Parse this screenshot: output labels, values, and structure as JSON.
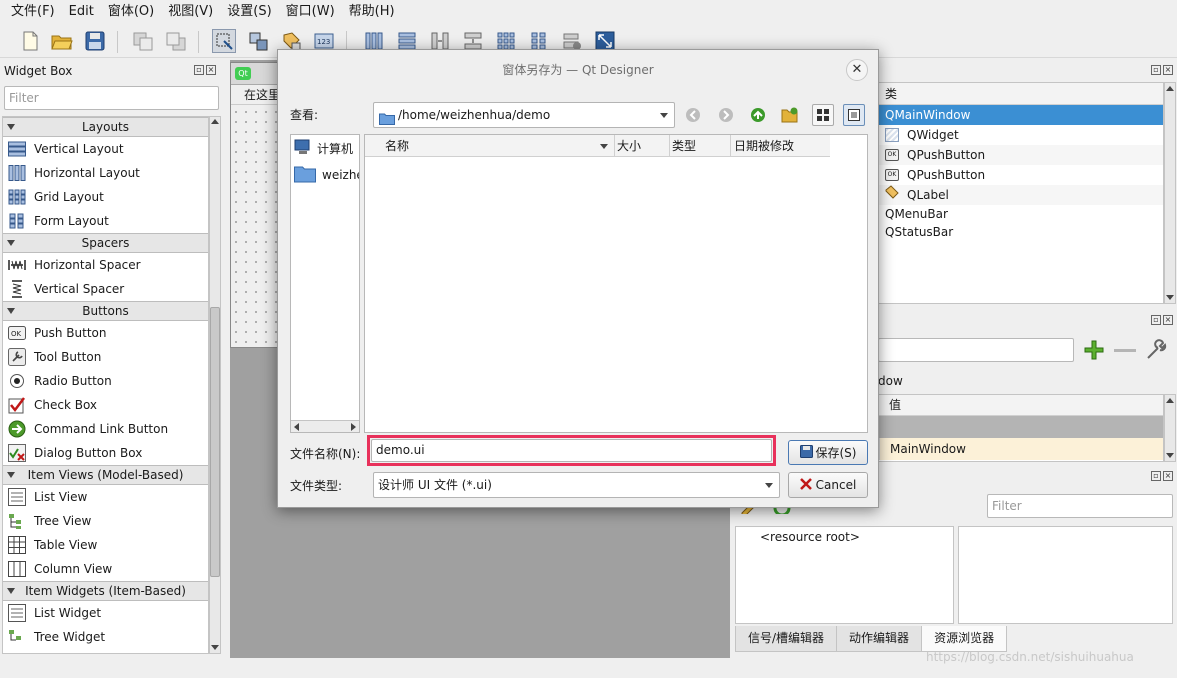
{
  "menubar": {
    "items": [
      "文件(F)",
      "Edit",
      "窗体(O)",
      "视图(V)",
      "设置(S)",
      "窗口(W)",
      "帮助(H)"
    ]
  },
  "toolbar": {
    "icons": [
      "new-form-icon",
      "open-form-icon",
      "save-form-icon",
      "send-to-back-icon",
      "bring-to-front-icon",
      "edit-widgets-icon",
      "edit-signals-slots-icon",
      "edit-buddies-icon",
      "edit-tab-order-icon",
      "lay-out-horizontally-icon",
      "lay-out-vertically-icon",
      "lay-out-horizontal-splitter-icon",
      "lay-out-vertical-splitter-icon",
      "lay-out-grid-icon",
      "lay-out-form-icon",
      "break-layout-icon",
      "adjust-size-icon"
    ]
  },
  "widget_box": {
    "title": "Widget Box",
    "filter_placeholder": "Filter",
    "categories": [
      {
        "name": "Layouts",
        "items": [
          {
            "label": "Vertical Layout",
            "icon": "vertical-layout-icon"
          },
          {
            "label": "Horizontal Layout",
            "icon": "horizontal-layout-icon"
          },
          {
            "label": "Grid Layout",
            "icon": "grid-layout-icon"
          },
          {
            "label": "Form Layout",
            "icon": "form-layout-icon"
          }
        ]
      },
      {
        "name": "Spacers",
        "items": [
          {
            "label": "Horizontal Spacer",
            "icon": "horizontal-spacer-icon"
          },
          {
            "label": "Vertical Spacer",
            "icon": "vertical-spacer-icon"
          }
        ]
      },
      {
        "name": "Buttons",
        "items": [
          {
            "label": "Push Button",
            "icon": "push-button-icon"
          },
          {
            "label": "Tool Button",
            "icon": "tool-button-icon"
          },
          {
            "label": "Radio Button",
            "icon": "radio-button-icon"
          },
          {
            "label": "Check Box",
            "icon": "check-box-icon"
          },
          {
            "label": "Command Link Button",
            "icon": "command-link-icon"
          },
          {
            "label": "Dialog Button Box",
            "icon": "dialog-button-box-icon"
          }
        ]
      },
      {
        "name": "Item Views (Model-Based)",
        "items": [
          {
            "label": "List View",
            "icon": "list-view-icon"
          },
          {
            "label": "Tree View",
            "icon": "tree-view-icon"
          },
          {
            "label": "Table View",
            "icon": "table-view-icon"
          },
          {
            "label": "Column View",
            "icon": "column-view-icon"
          }
        ]
      },
      {
        "name": "Item Widgets (Item-Based)",
        "items": [
          {
            "label": "List Widget",
            "icon": "list-widget-icon"
          },
          {
            "label": "Tree Widget",
            "icon": "tree-widget-icon"
          }
        ]
      }
    ]
  },
  "form": {
    "menu_placeholder": "在这里"
  },
  "object_inspector": {
    "col_header": "类",
    "rows": [
      {
        "label": "QMainWindow",
        "selected": true,
        "icon": ""
      },
      {
        "label": "QWidget",
        "icon": "widget-icon"
      },
      {
        "label": "QPushButton",
        "icon": "push-button-icon"
      },
      {
        "label": "QPushButton",
        "icon": "push-button-icon"
      },
      {
        "label": "QLabel",
        "icon": "label-icon"
      },
      {
        "label": "QMenuBar",
        "icon": ""
      },
      {
        "label": "QStatusBar",
        "icon": ""
      }
    ]
  },
  "property_editor": {
    "partial_class_label": "dow",
    "value_header": "值",
    "value_row": "MainWindow"
  },
  "resource_browser": {
    "filter_placeholder": "Filter",
    "root_label": "<resource root>",
    "tabs": [
      "信号/槽编辑器",
      "动作编辑器",
      "资源浏览器"
    ],
    "active_tab": 2
  },
  "watermark": "https://blog.csdn.net/sishuihuahua",
  "dialog": {
    "title": "窗体另存为 — Qt Designer",
    "close_glyph": "✕",
    "look_in_label": "查看:",
    "look_in_path": "/home/weizhenhua/demo",
    "sidebar": [
      {
        "label": "计算机",
        "icon": "computer-icon"
      },
      {
        "label": "weizhe",
        "icon": "folder-icon"
      }
    ],
    "columns": [
      "名称",
      "大小",
      "类型",
      "日期被修改"
    ],
    "filename_label": "文件名称(N):",
    "filename_value": "demo.ui",
    "filetype_label": "文件类型:",
    "filetype_value": "设计师 UI 文件 (*.ui)",
    "save_label": "保存(S)",
    "cancel_label": "Cancel",
    "highlight_color": "#e8315b"
  }
}
